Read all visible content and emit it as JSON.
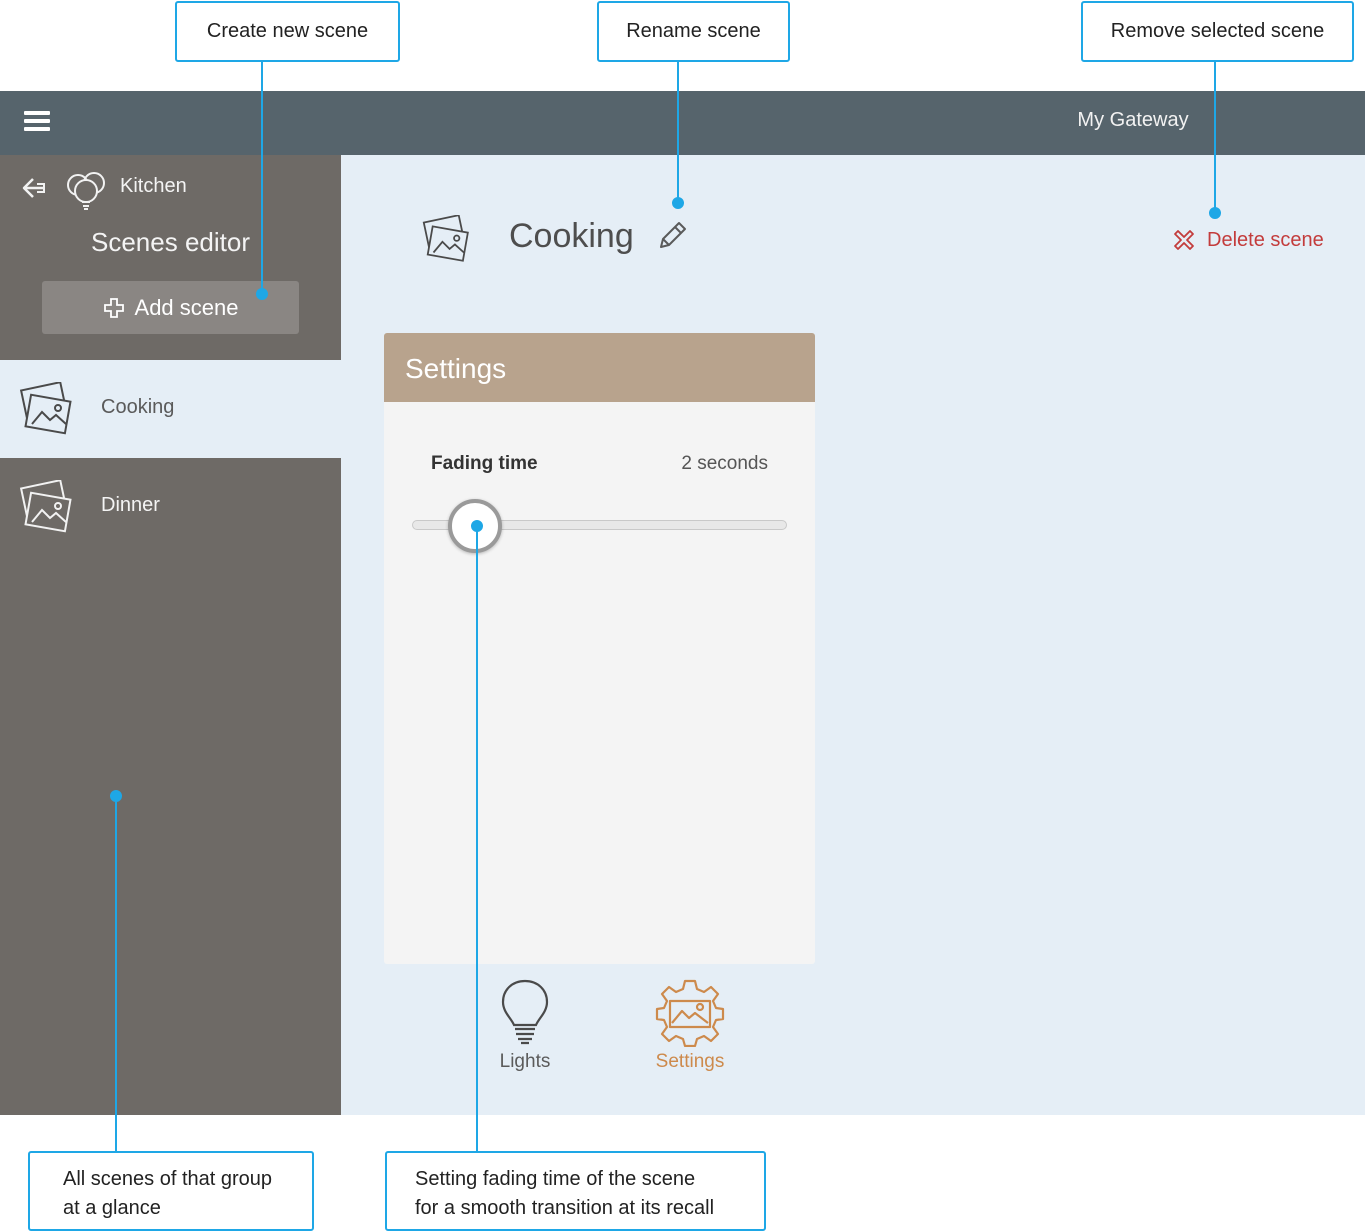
{
  "app": {
    "gateway_label": "My Gateway",
    "accent_color": "#56646c"
  },
  "sidebar": {
    "group_name": "Kitchen",
    "title": "Scenes editor",
    "add_button_label": "Add scene",
    "scenes": [
      {
        "label": "Cooking",
        "selected": true
      },
      {
        "label": "Dinner",
        "selected": false
      }
    ]
  },
  "main": {
    "scene_title": "Cooking",
    "delete_label": "Delete scene",
    "delete_color": "#c33c3c",
    "settings_card": {
      "header": "Settings",
      "header_color": "#b8a38d",
      "fading_label": "Fading time",
      "fading_value": "2 seconds",
      "slider_level": 0.17
    },
    "tabs": [
      {
        "label": "Lights",
        "icon": "bulb-icon",
        "active": false
      },
      {
        "label": "Settings",
        "icon": "gear-landscape-icon",
        "active": true
      }
    ]
  },
  "callouts": {
    "create_scene": "Create new scene",
    "rename_scene": "Rename scene",
    "remove_scene": "Remove selected scene",
    "all_scenes": [
      "All scenes of that group",
      "at a glance"
    ],
    "fading_time": [
      "Setting fading time of the scene",
      "for a smooth transition at its recall"
    ],
    "line_color": "#1ea7e6"
  }
}
